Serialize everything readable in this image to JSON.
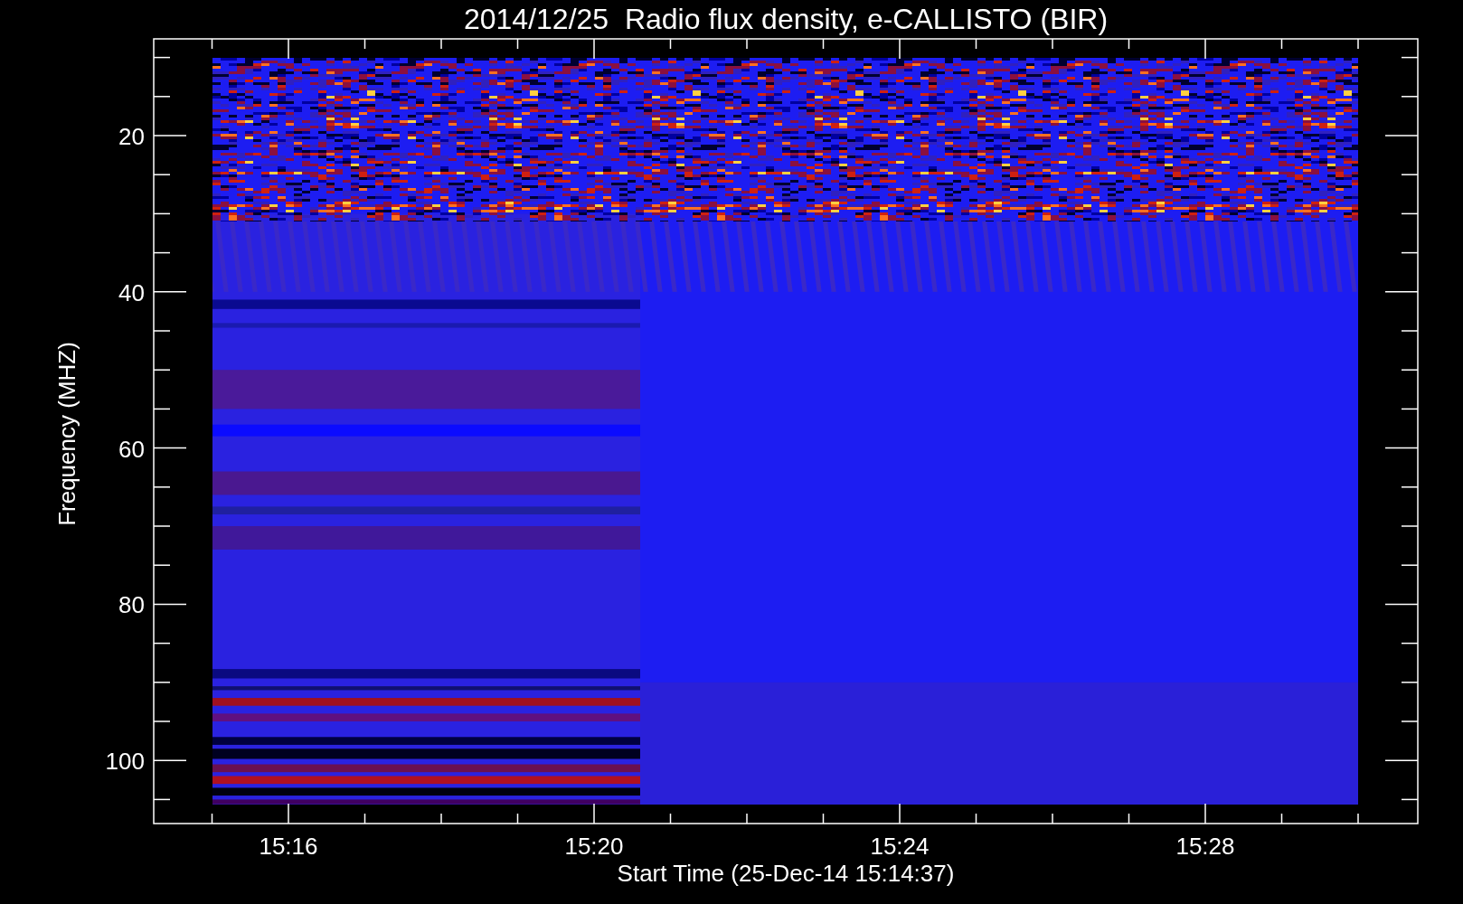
{
  "title": "2014/12/25  Radio flux density, e-CALLISTO (BIR)",
  "ylabel": "Frequency (MHZ)",
  "xlabel": "Start Time (25-Dec-14 15:14:37)",
  "yticks": [
    "20",
    "40",
    "60",
    "80",
    "100"
  ],
  "xticks": [
    "15:16",
    "15:20",
    "15:24",
    "15:28"
  ]
}
